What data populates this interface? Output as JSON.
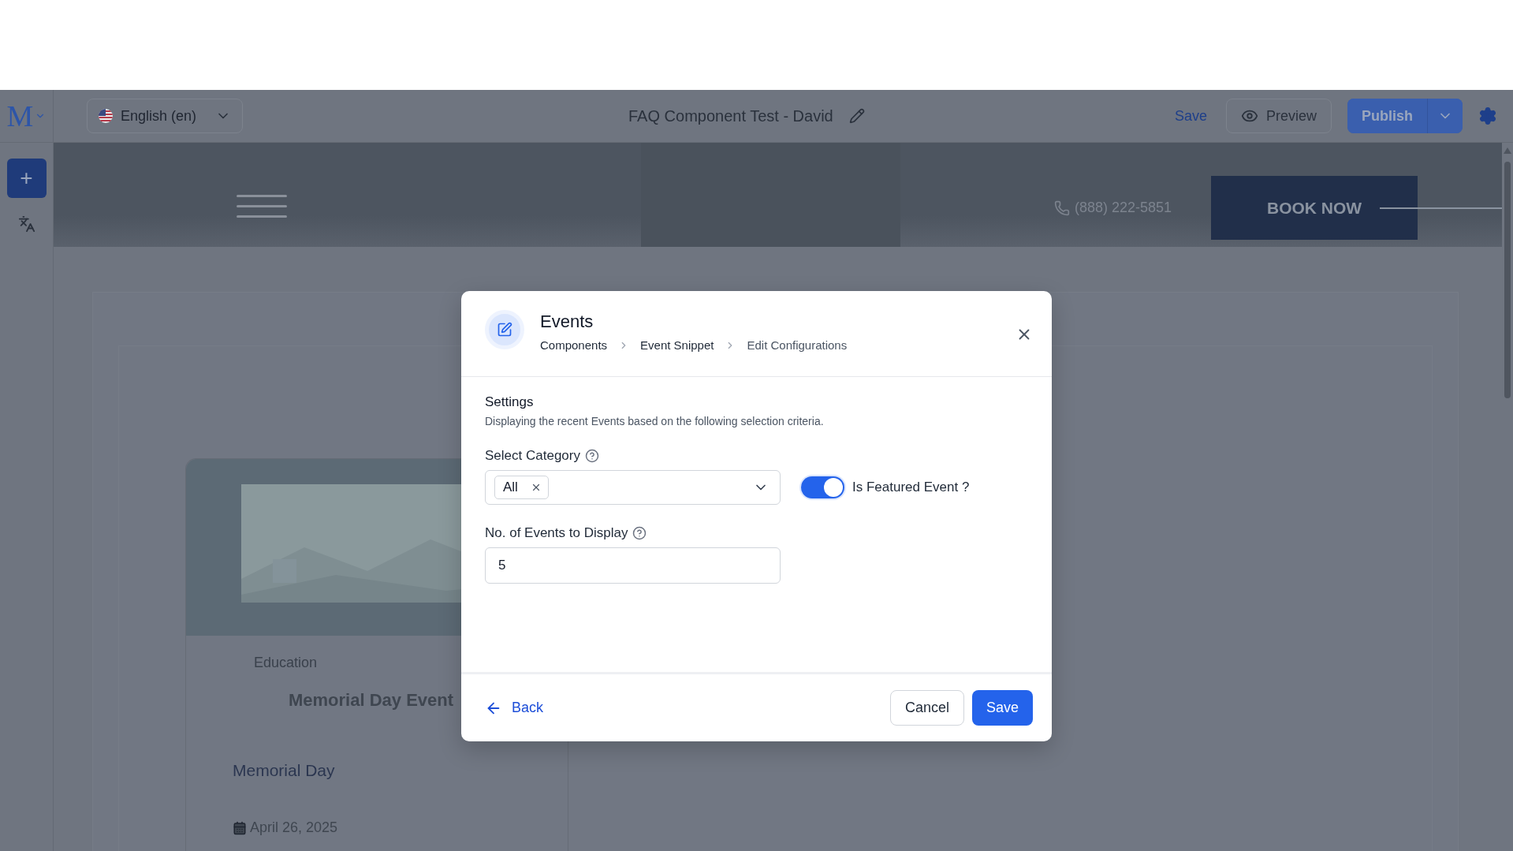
{
  "toolbar": {
    "logo": "M",
    "language": "English (en)",
    "page_title": "FAQ Component Test - David",
    "save": "Save",
    "preview": "Preview",
    "publish": "Publish"
  },
  "sidebar": {
    "add_button": "+"
  },
  "page_preview": {
    "phone": "(888) 222-5851",
    "book_button": "BOOK NOW",
    "event_card": {
      "category": "Education",
      "title": "Memorial Day Event",
      "name": "Memorial Day",
      "date": "April 26, 2025"
    }
  },
  "modal": {
    "title": "Events",
    "breadcrumbs": [
      "Components",
      "Event Snippet",
      "Edit Configurations"
    ],
    "section_title": "Settings",
    "section_description": "Displaying the recent Events based on the following selection criteria.",
    "category_field": {
      "label": "Select Category",
      "tags": [
        "All"
      ]
    },
    "featured_toggle": {
      "label": "Is Featured Event ?",
      "on": true
    },
    "count_field": {
      "label": "No. of Events to Display",
      "value": "5"
    },
    "back": "Back",
    "cancel": "Cancel",
    "save": "Save"
  }
}
